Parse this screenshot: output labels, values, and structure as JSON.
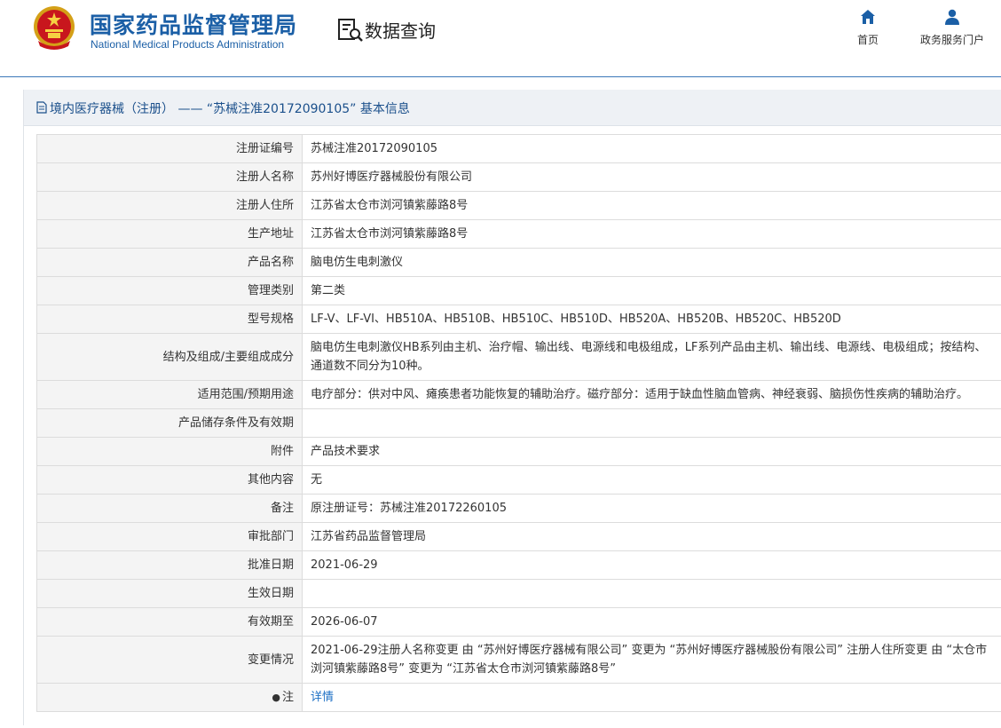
{
  "header": {
    "brand_cn": "国家药品监督管理局",
    "brand_en": "National Medical Products Administration",
    "section_title": "数据查询",
    "nav": [
      {
        "label": "首页",
        "icon": "home-icon"
      },
      {
        "label": "政务服务门户",
        "icon": "user-icon"
      }
    ]
  },
  "panel": {
    "title": "境内医疗器械（注册） ——  “苏械注准20172090105” 基本信息"
  },
  "rows": [
    {
      "key": "注册证编号",
      "value": "苏械注准20172090105"
    },
    {
      "key": "注册人名称",
      "value": "苏州好博医疗器械股份有限公司"
    },
    {
      "key": "注册人住所",
      "value": "江苏省太仓市浏河镇紫藤路8号"
    },
    {
      "key": "生产地址",
      "value": "江苏省太仓市浏河镇紫藤路8号"
    },
    {
      "key": "产品名称",
      "value": "脑电仿生电刺激仪"
    },
    {
      "key": "管理类别",
      "value": "第二类"
    },
    {
      "key": "型号规格",
      "value": "LF-V、LF-VI、HB510A、HB510B、HB510C、HB510D、HB520A、HB520B、HB520C、HB520D"
    },
    {
      "key": "结构及组成/主要组成成分",
      "value": "脑电仿生电刺激仪HB系列由主机、治疗帽、输出线、电源线和电极组成，LF系列产品由主机、输出线、电源线、电极组成；按结构、通道数不同分为10种。"
    },
    {
      "key": "适用范围/预期用途",
      "value": "电疗部分：供对中风、瘫痪患者功能恢复的辅助治疗。磁疗部分：适用于缺血性脑血管病、神经衰弱、脑损伤性疾病的辅助治疗。"
    },
    {
      "key": "产品储存条件及有效期",
      "value": ""
    },
    {
      "key": "附件",
      "value": "产品技术要求"
    },
    {
      "key": "其他内容",
      "value": "无"
    },
    {
      "key": "备注",
      "value": "原注册证号：苏械注准20172260105"
    },
    {
      "key": "审批部门",
      "value": "江苏省药品监督管理局"
    },
    {
      "key": "批准日期",
      "value": "2021-06-29"
    },
    {
      "key": "生效日期",
      "value": ""
    },
    {
      "key": "有效期至",
      "value": "2026-06-07"
    },
    {
      "key": "变更情况",
      "value": "2021-06-29注册人名称变更 由 “苏州好博医疗器械有限公司” 变更为 “苏州好博医疗器械股份有限公司” 注册人住所变更 由 “太仓市浏河镇紫藤路8号” 变更为 “江苏省太仓市浏河镇紫藤路8号”"
    }
  ],
  "note_row": {
    "pin": "●",
    "key": "注",
    "link": "详情"
  }
}
